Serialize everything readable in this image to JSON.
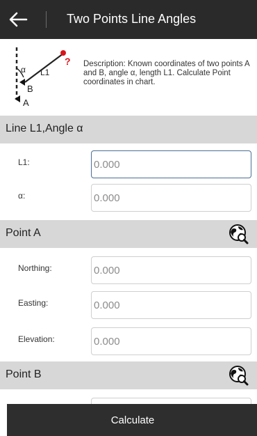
{
  "header": {
    "title": "Two Points Line Angles",
    "back_icon": "back-arrow-icon"
  },
  "description": {
    "text": "Description: Known coordinates of two points A and B, angle α, length L1. Calculate Point coordinates in chart.",
    "diagram": {
      "label_alpha": "α",
      "label_l1": "L1",
      "label_b": "B",
      "label_a": "A",
      "label_unknown": "?"
    }
  },
  "sections": {
    "line": {
      "title": "Line L1,Angle α",
      "rows": [
        {
          "label": "L1:",
          "placeholder": "0.000"
        },
        {
          "label": "α:",
          "placeholder": "0.000"
        }
      ]
    },
    "point_a": {
      "title": "Point A",
      "icon": "globe-search-icon",
      "rows": [
        {
          "label": "Northing:",
          "placeholder": "0.000"
        },
        {
          "label": "Easting:",
          "placeholder": "0.000"
        },
        {
          "label": "Elevation:",
          "placeholder": "0.000"
        }
      ]
    },
    "point_b": {
      "title": "Point B",
      "icon": "globe-search-icon"
    }
  },
  "footer": {
    "calculate_label": "Calculate"
  },
  "colors": {
    "header_bg": "#2a2a2a",
    "section_bg": "#d7d7d7",
    "focus_border": "#4a6d93",
    "unknown_point": "#d9141b",
    "button_bg": "#2e2e2e"
  }
}
